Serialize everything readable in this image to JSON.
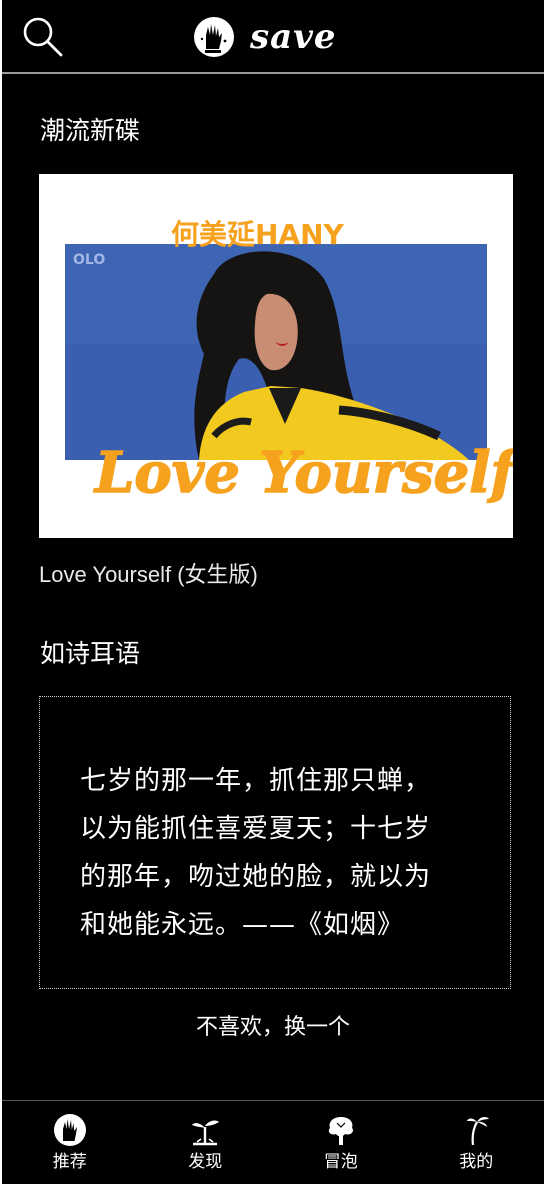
{
  "header": {
    "search_icon": "search-icon",
    "logo_icon": "hand-logo-icon",
    "app_name": "save"
  },
  "album_section": {
    "title": "潮流新碟",
    "album": {
      "cover_artist": "何美延HANY",
      "cover_brand": "OLO",
      "cover_title": "Love Yourself",
      "caption": "Love Yourself (女生版)"
    }
  },
  "poem_section": {
    "title": "如诗耳语",
    "lines": [
      "七岁的那一年，抓住那只蝉，",
      "以为能抓住喜爱夏天；十七岁",
      "的那年，吻过她的脸，就以为",
      "和她能永远。——《如烟》"
    ],
    "refresh_label": "不喜欢，换一个"
  },
  "tabbar": {
    "tabs": [
      {
        "label": "推荐",
        "icon": "hand-logo-icon"
      },
      {
        "label": "发现",
        "icon": "sprout-icon"
      },
      {
        "label": "冒泡",
        "icon": "tree-icon"
      },
      {
        "label": "我的",
        "icon": "palm-tree-icon"
      }
    ]
  },
  "colors": {
    "background": "#000000",
    "text": "#ffffff",
    "cover_blue": "#3a5fb0",
    "cover_orange": "#f6a21e",
    "jacket_yellow": "#f2c91f"
  }
}
